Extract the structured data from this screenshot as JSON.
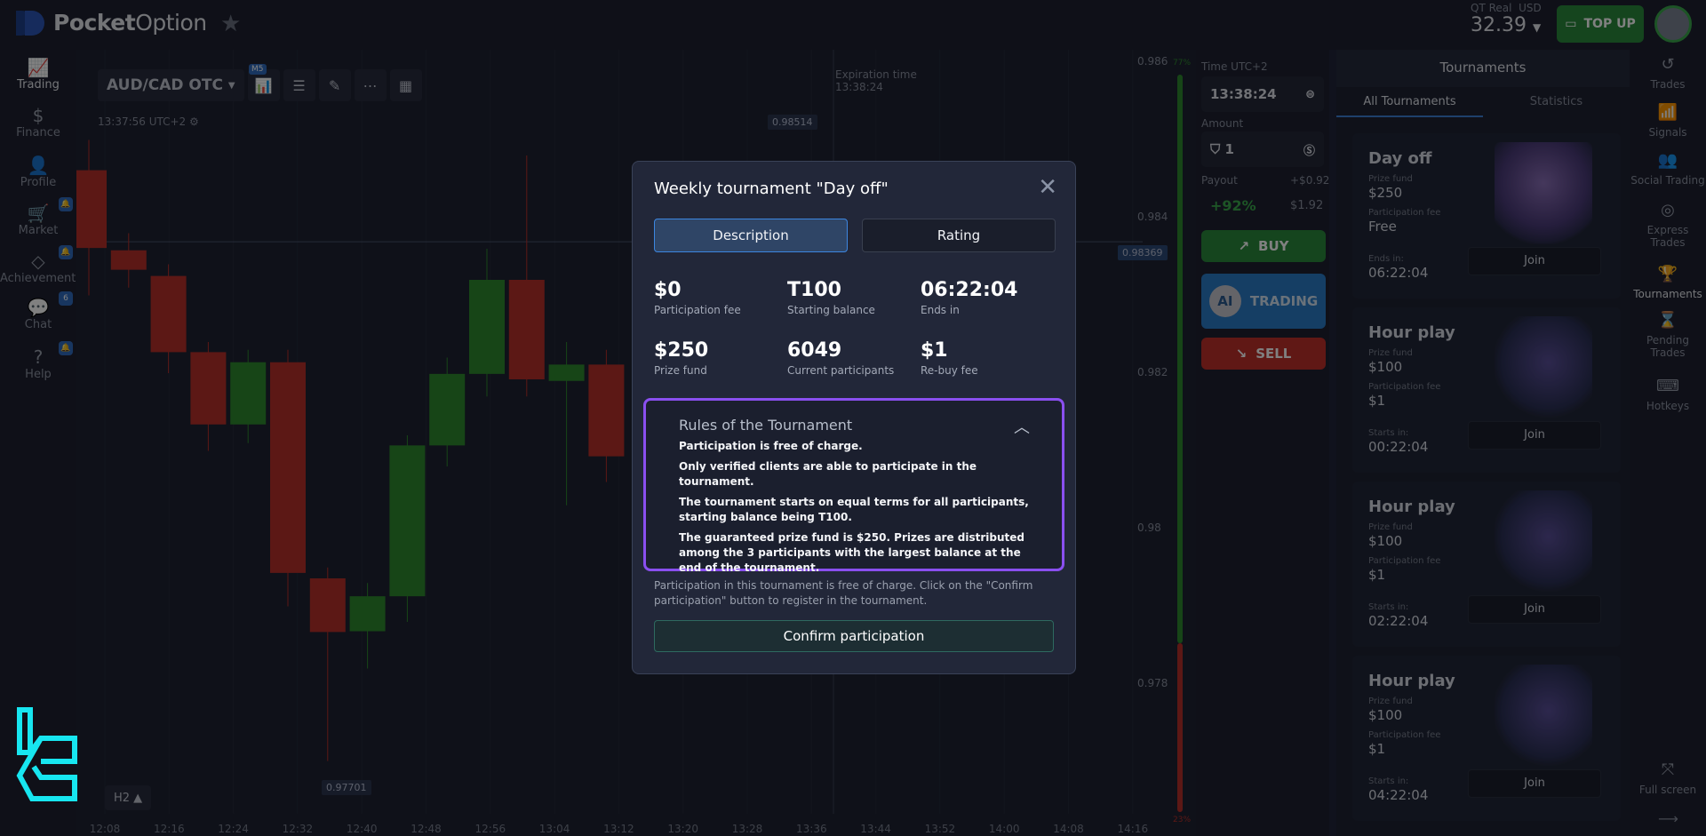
{
  "header": {
    "brand_bold": "Pocket",
    "brand_light": "Option",
    "account_type": "QT Real",
    "currency": "USD",
    "balance": "32.39",
    "top_up": "TOP UP"
  },
  "left_sidebar": [
    {
      "label": "Trading",
      "icon": "chart-line-icon",
      "glyph": "📈",
      "active": true
    },
    {
      "label": "Finance",
      "icon": "dollar-icon",
      "glyph": "$"
    },
    {
      "label": "Profile",
      "icon": "user-icon",
      "glyph": "👤"
    },
    {
      "label": "Market",
      "icon": "cart-icon",
      "glyph": "🛒",
      "badge": "🔔"
    },
    {
      "label": "Achievements",
      "icon": "diamond-icon",
      "glyph": "◇",
      "badge": "🔔"
    },
    {
      "label": "Chat",
      "icon": "chat-icon",
      "glyph": "💬",
      "badge": "6"
    },
    {
      "label": "Help",
      "icon": "help-icon",
      "glyph": "?",
      "badge": "🔔"
    }
  ],
  "chart": {
    "asset": "AUD/CAD OTC",
    "timeframe_badge": "M5",
    "clock": "13:37:56 UTC+2",
    "expiration_label": "Expiration time",
    "expiration_value": "13:38:24",
    "current_price": "0.98369",
    "high_label": "0.98514",
    "low_label": "0.97701",
    "period": "H2",
    "buy_pct": "77%",
    "sell_pct": "23%",
    "price_ticks": [
      "0.986",
      "0.984",
      "0.982",
      "0.98",
      "0.978"
    ],
    "time_ticks": [
      "12:08",
      "12:16",
      "12:24",
      "12:32",
      "12:40",
      "12:48",
      "12:56",
      "13:04",
      "13:12",
      "13:20",
      "13:28",
      "13:36",
      "13:44",
      "13:52",
      "14:00",
      "14:08",
      "14:16"
    ],
    "candles": [
      [
        0.98461,
        0.985,
        0.983,
        0.98361
      ],
      [
        0.98358,
        0.9838,
        0.9831,
        0.98333
      ],
      [
        0.98325,
        0.9834,
        0.982,
        0.98227
      ],
      [
        0.98227,
        0.9824,
        0.981,
        0.98134
      ],
      [
        0.98134,
        0.9823,
        0.9811,
        0.98214
      ],
      [
        0.98214,
        0.9823,
        0.979,
        0.97943
      ],
      [
        0.97936,
        0.9795,
        0.97701,
        0.97867
      ],
      [
        0.97868,
        0.9793,
        0.9782,
        0.97913
      ],
      [
        0.97913,
        0.9812,
        0.9788,
        0.98107
      ],
      [
        0.98107,
        0.9822,
        0.9808,
        0.98199
      ],
      [
        0.98199,
        0.9836,
        0.9817,
        0.9832
      ],
      [
        0.9832,
        0.9848,
        0.9817,
        0.98192
      ],
      [
        0.9819,
        0.9824,
        0.9803,
        0.98211
      ],
      [
        0.98211,
        0.9823,
        0.9806,
        0.98093
      ]
    ],
    "up_color": "#2e8a2e",
    "down_color": "#b8302a"
  },
  "trade_panel": {
    "time_label": "Time UTC+2",
    "time": "13:38:24",
    "amount_label": "Amount",
    "amount": "1",
    "payout_label": "Payout",
    "payout_profit": "+$0.92",
    "payout_pct": "+92%",
    "payout_total": "$1.92",
    "buy": "BUY",
    "ai_badge": "AI",
    "ai_label": "TRADING",
    "sell": "SELL"
  },
  "tournaments": {
    "title": "Tournaments",
    "tabs": [
      "All Tournaments",
      "Statistics"
    ],
    "cards": [
      {
        "name": "Day off",
        "prize_label": "Prize fund",
        "prize": "$250",
        "fee_label": "Participation fee",
        "fee": "Free",
        "time_label": "Ends in:",
        "time": "06:22:04",
        "join": "Join",
        "image": "trophy"
      },
      {
        "name": "Hour play",
        "prize_label": "Prize fund",
        "prize": "$100",
        "fee_label": "Participation fee",
        "fee": "$1",
        "time_label": "Starts in:",
        "time": "00:22:04",
        "join": "Join",
        "image": "clock"
      },
      {
        "name": "Hour play",
        "prize_label": "Prize fund",
        "prize": "$100",
        "fee_label": "Participation fee",
        "fee": "$1",
        "time_label": "Starts in:",
        "time": "02:22:04",
        "join": "Join",
        "image": "clock"
      },
      {
        "name": "Hour play",
        "prize_label": "Prize fund",
        "prize": "$100",
        "fee_label": "Participation fee",
        "fee": "$1",
        "time_label": "Starts in:",
        "time": "04:22:04",
        "join": "Join",
        "image": "clock"
      }
    ]
  },
  "right_sidebar": [
    {
      "label": "Trades",
      "icon": "history-icon",
      "glyph": "↺"
    },
    {
      "label": "Signals",
      "icon": "signal-icon",
      "glyph": "📶"
    },
    {
      "label": "Social Trading",
      "icon": "users-icon",
      "glyph": "👥"
    },
    {
      "label": "Express Trades",
      "icon": "target-icon",
      "glyph": "◎"
    },
    {
      "label": "Tournaments",
      "icon": "trophy-icon",
      "glyph": "🏆",
      "active": true
    },
    {
      "label": "Pending Trades",
      "icon": "hourglass-icon",
      "glyph": "⌛"
    },
    {
      "label": "Hotkeys",
      "icon": "keyboard-icon",
      "glyph": "⌨"
    }
  ],
  "fullscreen": "Full screen",
  "modal": {
    "title": "Weekly tournament \"Day off\"",
    "tabs": {
      "description": "Description",
      "rating": "Rating"
    },
    "stats": [
      {
        "value": "$0",
        "label": "Participation fee"
      },
      {
        "value": "T100",
        "label": "Starting balance"
      },
      {
        "value": "06:22:04",
        "label": "Ends in"
      },
      {
        "value": "$250",
        "label": "Prize fund"
      },
      {
        "value": "6049",
        "label": "Current participants"
      },
      {
        "value": "$1",
        "label": "Re-buy fee"
      }
    ],
    "rules_title": "Rules of the Tournament",
    "rules": [
      "Participation is free of charge.",
      "Only verified clients are able to participate in the tournament.",
      "The tournament starts on equal terms for all participants, starting balance being T100.",
      "The guaranteed prize fund is $250. Prizes are distributed among the 3 participants with the largest balance at the end of the tournament."
    ],
    "note": "Participation in this tournament is free of charge. Click on the \"Confirm participation\" button to register in the tournament.",
    "confirm": "Confirm participation",
    "highlight_color": "#8a4ff0"
  },
  "watermark": "TC"
}
